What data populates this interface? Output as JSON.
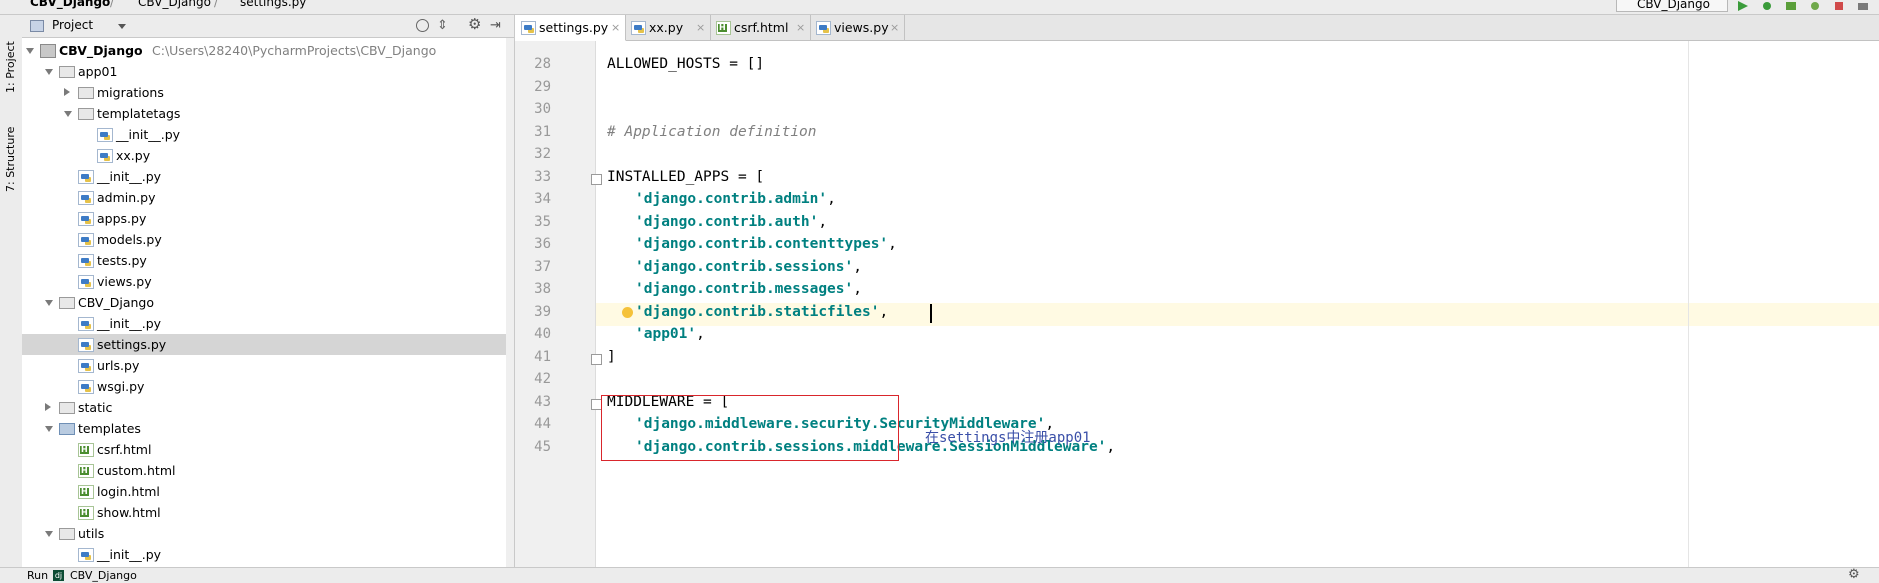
{
  "breadcrumb": {
    "root": "CBV_Django",
    "folder": "CBV_Django",
    "file": "settings.py"
  },
  "run_config": {
    "label": "CBV_Django"
  },
  "left_strip": {
    "project_tab": "1: Project",
    "structure_tab": "7: Structure"
  },
  "project_panel": {
    "title": "Project",
    "tree": [
      {
        "label": "CBV_Django",
        "path": "C:\\Users\\28240\\PycharmProjects\\CBV_Django",
        "type": "module",
        "level": 0,
        "expanded": true
      },
      {
        "label": "app01",
        "type": "folder",
        "level": 1,
        "expanded": true
      },
      {
        "label": "migrations",
        "type": "folder",
        "level": 2,
        "expanded": false
      },
      {
        "label": "templatetags",
        "type": "folder",
        "level": 2,
        "expanded": true
      },
      {
        "label": "__init__.py",
        "type": "py",
        "level": 3
      },
      {
        "label": "xx.py",
        "type": "py",
        "level": 3
      },
      {
        "label": "__init__.py",
        "type": "py",
        "level": 2
      },
      {
        "label": "admin.py",
        "type": "py",
        "level": 2
      },
      {
        "label": "apps.py",
        "type": "py",
        "level": 2
      },
      {
        "label": "models.py",
        "type": "py",
        "level": 2
      },
      {
        "label": "tests.py",
        "type": "py",
        "level": 2
      },
      {
        "label": "views.py",
        "type": "py",
        "level": 2
      },
      {
        "label": "CBV_Django",
        "type": "folder",
        "level": 1,
        "expanded": true
      },
      {
        "label": "__init__.py",
        "type": "py",
        "level": 2
      },
      {
        "label": "settings.py",
        "type": "py",
        "level": 2,
        "selected": true
      },
      {
        "label": "urls.py",
        "type": "py",
        "level": 2
      },
      {
        "label": "wsgi.py",
        "type": "py",
        "level": 2
      },
      {
        "label": "static",
        "type": "folder",
        "level": 1,
        "expanded": false
      },
      {
        "label": "templates",
        "type": "folder-blue",
        "level": 1,
        "expanded": true
      },
      {
        "label": "csrf.html",
        "type": "html",
        "level": 2
      },
      {
        "label": "custom.html",
        "type": "html",
        "level": 2
      },
      {
        "label": "login.html",
        "type": "html",
        "level": 2
      },
      {
        "label": "show.html",
        "type": "html",
        "level": 2
      },
      {
        "label": "utils",
        "type": "folder",
        "level": 1,
        "expanded": true
      },
      {
        "label": "__init__.py",
        "type": "py",
        "level": 2
      }
    ]
  },
  "editor_tabs": [
    {
      "label": "settings.py",
      "type": "py",
      "active": true
    },
    {
      "label": "xx.py",
      "type": "py",
      "active": false
    },
    {
      "label": "csrf.html",
      "type": "html",
      "active": false
    },
    {
      "label": "views.py",
      "type": "py",
      "active": false
    }
  ],
  "code_lines": [
    {
      "n": "28",
      "text": "ALLOWED_HOSTS = []",
      "kind": "plain"
    },
    {
      "n": "29",
      "text": "",
      "kind": "plain"
    },
    {
      "n": "30",
      "text": "",
      "kind": "plain"
    },
    {
      "n": "31",
      "text": "# Application definition",
      "kind": "comment"
    },
    {
      "n": "32",
      "text": "",
      "kind": "plain"
    },
    {
      "n": "33",
      "text": "INSTALLED_APPS = [",
      "kind": "plain"
    },
    {
      "n": "34",
      "text": "'django.contrib.admin'",
      "kind": "string",
      "suffix": ","
    },
    {
      "n": "35",
      "text": "'django.contrib.auth'",
      "kind": "string",
      "suffix": ","
    },
    {
      "n": "36",
      "text": "'django.contrib.contenttypes'",
      "kind": "string",
      "suffix": ","
    },
    {
      "n": "37",
      "text": "'django.contrib.sessions'",
      "kind": "string",
      "suffix": ","
    },
    {
      "n": "38",
      "text": "'django.contrib.messages'",
      "kind": "string",
      "suffix": ","
    },
    {
      "n": "39",
      "text": "'django.contrib.staticfiles'",
      "kind": "string",
      "suffix": ","
    },
    {
      "n": "40",
      "text": "'app01'",
      "kind": "string",
      "suffix": ","
    },
    {
      "n": "41",
      "text": "]",
      "kind": "plain"
    },
    {
      "n": "42",
      "text": "",
      "kind": "plain"
    },
    {
      "n": "43",
      "text": "MIDDLEWARE = [",
      "kind": "plain"
    },
    {
      "n": "44",
      "text": "'django.middleware.security.SecurityMiddleware'",
      "kind": "string",
      "suffix": ","
    },
    {
      "n": "45",
      "text": "'django.contrib.sessions.middleware.SessionMiddleware'",
      "kind": "string",
      "suffix": ","
    }
  ],
  "annotation": "在settings中注册app01",
  "statusbar": {
    "run_label": "Run",
    "run_config": "CBV_Django"
  },
  "colors": {
    "string": "#008080",
    "comment": "#808080",
    "annotation_box": "#d9262c",
    "annotation_text": "#3a4fa8",
    "selection": "#d5d5d5"
  }
}
